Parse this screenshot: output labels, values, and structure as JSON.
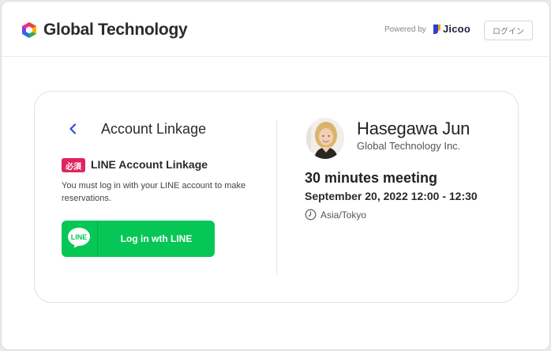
{
  "header": {
    "brand_name": "Global Technology",
    "powered_by": "Powered by",
    "jicoo_label": "Jicoo",
    "login_label": "ログイン"
  },
  "left": {
    "title": "Account Linkage",
    "badge": "必須",
    "section_title": "LINE Account Linkage",
    "description": "You must log in with your LINE account to make reservations.",
    "line_logo_text": "LINE",
    "line_button_label": "Log in wth LINE"
  },
  "right": {
    "host_name": "Hasegawa Jun",
    "host_company": "Global Technology Inc.",
    "meeting_title": "30 minutes meeting",
    "meeting_date": "September 20, 2022 12:00 - 12:30",
    "timezone": "Asia/Tokyo"
  },
  "icons": {
    "brand": "hexagon-multicolor-logo",
    "jicoo": "jicoo-logo",
    "back": "chevron-left-icon",
    "line": "line-logo",
    "clock": "clock-icon"
  },
  "colors": {
    "line_green": "#06c755",
    "badge_red": "#e0245e",
    "back_chevron": "#3b4bd8"
  }
}
